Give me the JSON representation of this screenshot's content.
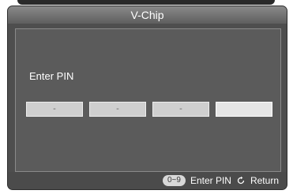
{
  "window": {
    "title": "V-Chip"
  },
  "pin_entry": {
    "label": "Enter PIN",
    "slots": [
      "-",
      "-",
      "-",
      ""
    ]
  },
  "footer": {
    "key_badge": "0~9",
    "enter_pin_label": "Enter PIN",
    "return_label": "Return"
  }
}
